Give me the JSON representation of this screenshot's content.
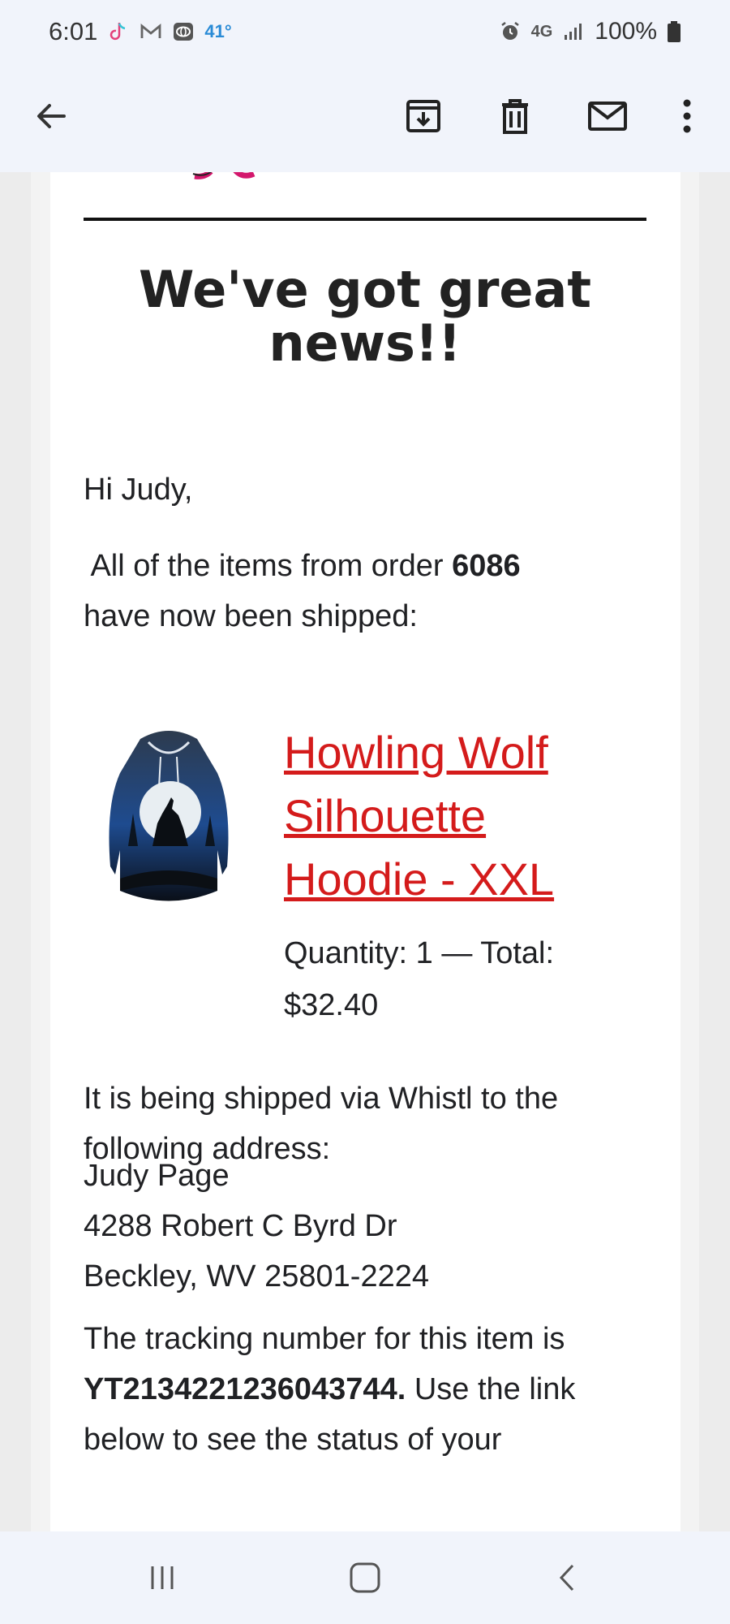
{
  "status_bar": {
    "time": "6:01",
    "temperature": "41°",
    "network": "4G",
    "battery": "100%"
  },
  "app_bar": {
    "icons": [
      "back-arrow-icon",
      "archive-icon",
      "trash-icon",
      "mail-icon",
      "more-vert-icon"
    ]
  },
  "email": {
    "headline": "We've got great news!!",
    "greeting": "Hi Judy,",
    "intro_prefix": " All of the items from order ",
    "order_number": "6086",
    "intro_suffix": "have now been shipped:",
    "product": {
      "name": "Howling Wolf Silhouette Hoodie - XXL",
      "quantity_label": "Quantity: 1 — Total:",
      "total": "$32.40",
      "link_color": "#d41b1b"
    },
    "shipping_line": "It is being shipped via Whistl to the following address:",
    "address": {
      "name": "Judy Page",
      "street": "4288 Robert C Byrd Dr",
      "city_line": "Beckley, WV 25801-2224"
    },
    "tracking_prefix": "The tracking number for this item is",
    "tracking_number": "YT2134221236043744.",
    "tracking_suffix": " Use the link below to see the status of your"
  },
  "nav_bar": {
    "icons": [
      "recent-apps-icon",
      "home-icon",
      "back-icon"
    ]
  }
}
